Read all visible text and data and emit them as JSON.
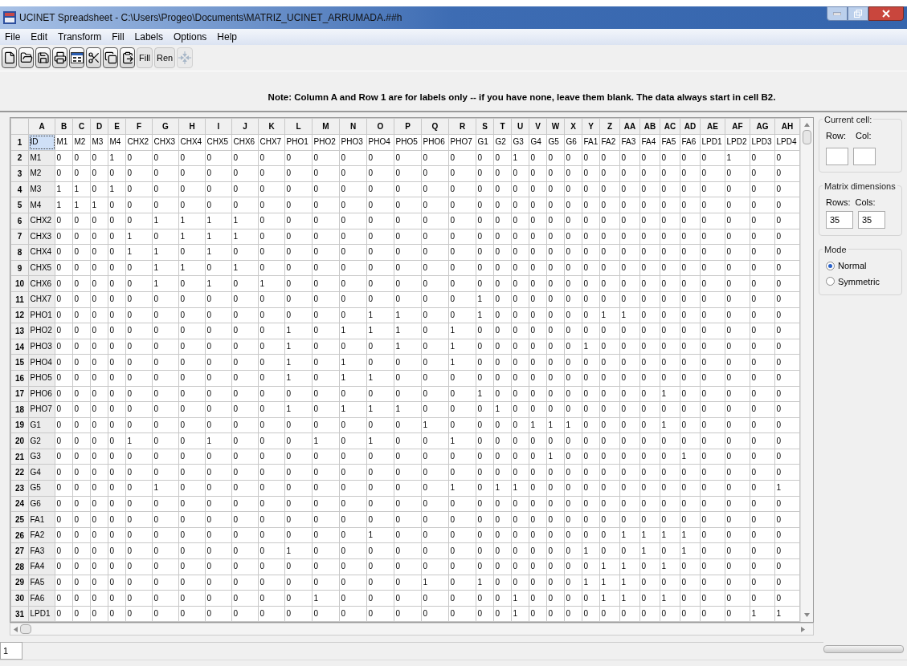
{
  "window": {
    "title": "UCINET Spreadsheet - C:\\Users\\Progeo\\Documents\\MATRIZ_UCINET_ARRUMADA.##h"
  },
  "menu": [
    "File",
    "Edit",
    "Transform",
    "Fill",
    "Labels",
    "Options",
    "Help"
  ],
  "toolbar": [
    {
      "kind": "new",
      "disabled": false
    },
    {
      "kind": "open",
      "disabled": false
    },
    {
      "kind": "save",
      "disabled": false
    },
    {
      "kind": "print",
      "disabled": false
    },
    {
      "kind": "grid",
      "disabled": false
    },
    {
      "kind": "cut",
      "disabled": false
    },
    {
      "kind": "copy",
      "disabled": false
    },
    {
      "kind": "paste",
      "disabled": false
    },
    {
      "kind": "text",
      "label": "Fill",
      "disabled": false
    },
    {
      "kind": "text",
      "label": "Ren",
      "disabled": false
    },
    {
      "kind": "arrows",
      "disabled": true
    }
  ],
  "note": "Note: Column A and Row 1 are for labels only  -- if you have none, leave them blank. The data always start in cell B2.",
  "grid": {
    "columns": [
      "A",
      "B",
      "C",
      "D",
      "E",
      "F",
      "G",
      "H",
      "I",
      "J",
      "K",
      "L",
      "M",
      "N",
      "O",
      "P",
      "Q",
      "R",
      "S",
      "T",
      "U",
      "V",
      "W",
      "X",
      "Y",
      "Z",
      "AA",
      "AB",
      "AC",
      "AD",
      "AE",
      "AF",
      "AG",
      "AH"
    ],
    "rows": [
      {
        "number": "1",
        "focused": true,
        "cells": [
          "ID",
          "M1",
          "M2",
          "M3",
          "M4",
          "CHX2",
          "CHX3",
          "CHX4",
          "CHX5",
          "CHX6",
          "CHX7",
          "PHO1",
          "PHO2",
          "PHO3",
          "PHO4",
          "PHO5",
          "PHO6",
          "PHO7",
          "G1",
          "G2",
          "G3",
          "G4",
          "G5",
          "G6",
          "FA1",
          "FA2",
          "FA3",
          "FA4",
          "FA5",
          "FA6",
          "LPD1",
          "LPD2",
          "LPD3",
          "LPD4"
        ]
      },
      {
        "number": "2",
        "focused": false,
        "cells": [
          "M1",
          "0",
          "0",
          "0",
          "1",
          "0",
          "0",
          "0",
          "0",
          "0",
          "0",
          "0",
          "0",
          "0",
          "0",
          "0",
          "0",
          "0",
          "0",
          "0",
          "1",
          "0",
          "0",
          "0",
          "0",
          "0",
          "0",
          "0",
          "0",
          "0",
          "0",
          "1",
          "0",
          "0"
        ]
      },
      {
        "number": "3",
        "focused": false,
        "cells": [
          "M2",
          "0",
          "0",
          "0",
          "0",
          "0",
          "0",
          "0",
          "0",
          "0",
          "0",
          "0",
          "0",
          "0",
          "0",
          "0",
          "0",
          "0",
          "0",
          "0",
          "0",
          "0",
          "0",
          "0",
          "0",
          "0",
          "0",
          "0",
          "0",
          "0",
          "0",
          "0",
          "0",
          "0"
        ]
      },
      {
        "number": "4",
        "focused": false,
        "cells": [
          "M3",
          "1",
          "1",
          "0",
          "1",
          "0",
          "0",
          "0",
          "0",
          "0",
          "0",
          "0",
          "0",
          "0",
          "0",
          "0",
          "0",
          "0",
          "0",
          "0",
          "0",
          "0",
          "0",
          "0",
          "0",
          "0",
          "0",
          "0",
          "0",
          "0",
          "0",
          "0",
          "0",
          "0"
        ]
      },
      {
        "number": "5",
        "focused": false,
        "cells": [
          "M4",
          "1",
          "1",
          "1",
          "0",
          "0",
          "0",
          "0",
          "0",
          "0",
          "0",
          "0",
          "0",
          "0",
          "0",
          "0",
          "0",
          "0",
          "0",
          "0",
          "0",
          "0",
          "0",
          "0",
          "0",
          "0",
          "0",
          "0",
          "0",
          "0",
          "0",
          "0",
          "0",
          "0"
        ]
      },
      {
        "number": "6",
        "focused": false,
        "cells": [
          "CHX2",
          "0",
          "0",
          "0",
          "0",
          "0",
          "1",
          "1",
          "1",
          "1",
          "0",
          "0",
          "0",
          "0",
          "0",
          "0",
          "0",
          "0",
          "0",
          "0",
          "0",
          "0",
          "0",
          "0",
          "0",
          "0",
          "0",
          "0",
          "0",
          "0",
          "0",
          "0",
          "0",
          "0"
        ]
      },
      {
        "number": "7",
        "focused": false,
        "cells": [
          "CHX3",
          "0",
          "0",
          "0",
          "0",
          "1",
          "0",
          "1",
          "1",
          "1",
          "0",
          "0",
          "0",
          "0",
          "0",
          "0",
          "0",
          "0",
          "0",
          "0",
          "0",
          "0",
          "0",
          "0",
          "0",
          "0",
          "0",
          "0",
          "0",
          "0",
          "0",
          "0",
          "0",
          "0"
        ]
      },
      {
        "number": "8",
        "focused": false,
        "cells": [
          "CHX4",
          "0",
          "0",
          "0",
          "0",
          "1",
          "1",
          "0",
          "1",
          "0",
          "0",
          "0",
          "0",
          "0",
          "0",
          "0",
          "0",
          "0",
          "0",
          "0",
          "0",
          "0",
          "0",
          "0",
          "0",
          "0",
          "0",
          "0",
          "0",
          "0",
          "0",
          "0",
          "0",
          "0"
        ]
      },
      {
        "number": "9",
        "focused": false,
        "cells": [
          "CHX5",
          "0",
          "0",
          "0",
          "0",
          "0",
          "1",
          "1",
          "0",
          "1",
          "0",
          "0",
          "0",
          "0",
          "0",
          "0",
          "0",
          "0",
          "0",
          "0",
          "0",
          "0",
          "0",
          "0",
          "0",
          "0",
          "0",
          "0",
          "0",
          "0",
          "0",
          "0",
          "0",
          "0"
        ]
      },
      {
        "number": "10",
        "focused": false,
        "cells": [
          "CHX6",
          "0",
          "0",
          "0",
          "0",
          "0",
          "1",
          "0",
          "1",
          "0",
          "1",
          "0",
          "0",
          "0",
          "0",
          "0",
          "0",
          "0",
          "0",
          "0",
          "0",
          "0",
          "0",
          "0",
          "0",
          "0",
          "0",
          "0",
          "0",
          "0",
          "0",
          "0",
          "0",
          "0"
        ]
      },
      {
        "number": "11",
        "focused": false,
        "cells": [
          "CHX7",
          "0",
          "0",
          "0",
          "0",
          "0",
          "0",
          "0",
          "0",
          "0",
          "0",
          "0",
          "0",
          "0",
          "0",
          "0",
          "0",
          "0",
          "1",
          "0",
          "0",
          "0",
          "0",
          "0",
          "0",
          "0",
          "0",
          "0",
          "0",
          "0",
          "0",
          "0",
          "0",
          "0"
        ]
      },
      {
        "number": "12",
        "focused": false,
        "cells": [
          "PHO1",
          "0",
          "0",
          "0",
          "0",
          "0",
          "0",
          "0",
          "0",
          "0",
          "0",
          "0",
          "0",
          "0",
          "1",
          "1",
          "0",
          "0",
          "1",
          "0",
          "0",
          "0",
          "0",
          "0",
          "0",
          "1",
          "1",
          "0",
          "0",
          "0",
          "0",
          "0",
          "0",
          "0"
        ]
      },
      {
        "number": "13",
        "focused": false,
        "cells": [
          "PHO2",
          "0",
          "0",
          "0",
          "0",
          "0",
          "0",
          "0",
          "0",
          "0",
          "0",
          "1",
          "0",
          "1",
          "1",
          "1",
          "0",
          "1",
          "0",
          "0",
          "0",
          "0",
          "0",
          "0",
          "0",
          "0",
          "0",
          "0",
          "0",
          "0",
          "0",
          "0",
          "0",
          "0"
        ]
      },
      {
        "number": "14",
        "focused": false,
        "cells": [
          "PHO3",
          "0",
          "0",
          "0",
          "0",
          "0",
          "0",
          "0",
          "0",
          "0",
          "0",
          "1",
          "0",
          "0",
          "0",
          "1",
          "0",
          "1",
          "0",
          "0",
          "0",
          "0",
          "0",
          "0",
          "1",
          "0",
          "0",
          "0",
          "0",
          "0",
          "0",
          "0",
          "0",
          "0"
        ]
      },
      {
        "number": "15",
        "focused": false,
        "cells": [
          "PHO4",
          "0",
          "0",
          "0",
          "0",
          "0",
          "0",
          "0",
          "0",
          "0",
          "0",
          "1",
          "0",
          "1",
          "0",
          "0",
          "0",
          "1",
          "0",
          "0",
          "0",
          "0",
          "0",
          "0",
          "0",
          "0",
          "0",
          "0",
          "0",
          "0",
          "0",
          "0",
          "0",
          "0"
        ]
      },
      {
        "number": "16",
        "focused": false,
        "cells": [
          "PHO5",
          "0",
          "0",
          "0",
          "0",
          "0",
          "0",
          "0",
          "0",
          "0",
          "0",
          "1",
          "0",
          "1",
          "1",
          "0",
          "0",
          "0",
          "0",
          "0",
          "0",
          "0",
          "0",
          "0",
          "0",
          "0",
          "0",
          "0",
          "0",
          "0",
          "0",
          "0",
          "0",
          "0"
        ]
      },
      {
        "number": "17",
        "focused": false,
        "cells": [
          "PHO6",
          "0",
          "0",
          "0",
          "0",
          "0",
          "0",
          "0",
          "0",
          "0",
          "0",
          "0",
          "0",
          "0",
          "0",
          "0",
          "0",
          "0",
          "1",
          "0",
          "0",
          "0",
          "0",
          "0",
          "0",
          "0",
          "0",
          "0",
          "1",
          "0",
          "0",
          "0",
          "0",
          "0"
        ]
      },
      {
        "number": "18",
        "focused": false,
        "cells": [
          "PHO7",
          "0",
          "0",
          "0",
          "0",
          "0",
          "0",
          "0",
          "0",
          "0",
          "0",
          "1",
          "0",
          "1",
          "1",
          "1",
          "0",
          "0",
          "0",
          "1",
          "0",
          "0",
          "0",
          "0",
          "0",
          "0",
          "0",
          "0",
          "0",
          "0",
          "0",
          "0",
          "0",
          "0"
        ]
      },
      {
        "number": "19",
        "focused": false,
        "cells": [
          "G1",
          "0",
          "0",
          "0",
          "0",
          "0",
          "0",
          "0",
          "0",
          "0",
          "0",
          "0",
          "0",
          "0",
          "0",
          "0",
          "1",
          "0",
          "0",
          "0",
          "0",
          "1",
          "1",
          "1",
          "0",
          "0",
          "0",
          "0",
          "1",
          "0",
          "0",
          "0",
          "0",
          "0"
        ]
      },
      {
        "number": "20",
        "focused": false,
        "cells": [
          "G2",
          "0",
          "0",
          "0",
          "0",
          "1",
          "0",
          "0",
          "1",
          "0",
          "0",
          "0",
          "1",
          "0",
          "1",
          "0",
          "0",
          "1",
          "0",
          "0",
          "0",
          "0",
          "0",
          "0",
          "0",
          "0",
          "0",
          "0",
          "0",
          "0",
          "0",
          "0",
          "0",
          "0"
        ]
      },
      {
        "number": "21",
        "focused": false,
        "cells": [
          "G3",
          "0",
          "0",
          "0",
          "0",
          "0",
          "0",
          "0",
          "0",
          "0",
          "0",
          "0",
          "0",
          "0",
          "0",
          "0",
          "0",
          "0",
          "0",
          "0",
          "0",
          "0",
          "1",
          "0",
          "0",
          "0",
          "0",
          "0",
          "0",
          "1",
          "0",
          "0",
          "0",
          "0"
        ]
      },
      {
        "number": "22",
        "focused": false,
        "cells": [
          "G4",
          "0",
          "0",
          "0",
          "0",
          "0",
          "0",
          "0",
          "0",
          "0",
          "0",
          "0",
          "0",
          "0",
          "0",
          "0",
          "0",
          "0",
          "0",
          "0",
          "0",
          "0",
          "0",
          "0",
          "0",
          "0",
          "0",
          "0",
          "0",
          "0",
          "0",
          "0",
          "0",
          "0"
        ]
      },
      {
        "number": "23",
        "focused": false,
        "cells": [
          "G5",
          "0",
          "0",
          "0",
          "0",
          "0",
          "1",
          "0",
          "0",
          "0",
          "0",
          "0",
          "0",
          "0",
          "0",
          "0",
          "0",
          "1",
          "0",
          "1",
          "1",
          "0",
          "0",
          "0",
          "0",
          "0",
          "0",
          "0",
          "0",
          "0",
          "0",
          "0",
          "0",
          "1"
        ]
      },
      {
        "number": "24",
        "focused": false,
        "cells": [
          "G6",
          "0",
          "0",
          "0",
          "0",
          "0",
          "0",
          "0",
          "0",
          "0",
          "0",
          "0",
          "0",
          "0",
          "0",
          "0",
          "0",
          "0",
          "0",
          "0",
          "0",
          "0",
          "0",
          "0",
          "0",
          "0",
          "0",
          "0",
          "0",
          "0",
          "0",
          "0",
          "0",
          "0"
        ]
      },
      {
        "number": "25",
        "focused": false,
        "cells": [
          "FA1",
          "0",
          "0",
          "0",
          "0",
          "0",
          "0",
          "0",
          "0",
          "0",
          "0",
          "0",
          "0",
          "0",
          "0",
          "0",
          "0",
          "0",
          "0",
          "0",
          "0",
          "0",
          "0",
          "0",
          "0",
          "0",
          "0",
          "0",
          "0",
          "0",
          "0",
          "0",
          "0",
          "0"
        ]
      },
      {
        "number": "26",
        "focused": false,
        "cells": [
          "FA2",
          "0",
          "0",
          "0",
          "0",
          "0",
          "0",
          "0",
          "0",
          "0",
          "0",
          "0",
          "0",
          "0",
          "1",
          "0",
          "0",
          "0",
          "0",
          "0",
          "0",
          "0",
          "0",
          "0",
          "0",
          "0",
          "1",
          "1",
          "1",
          "1",
          "0",
          "0",
          "0",
          "0"
        ]
      },
      {
        "number": "27",
        "focused": false,
        "cells": [
          "FA3",
          "0",
          "0",
          "0",
          "0",
          "0",
          "0",
          "0",
          "0",
          "0",
          "0",
          "1",
          "0",
          "0",
          "0",
          "0",
          "0",
          "0",
          "0",
          "0",
          "0",
          "0",
          "0",
          "0",
          "1",
          "0",
          "0",
          "1",
          "0",
          "1",
          "0",
          "0",
          "0",
          "0"
        ]
      },
      {
        "number": "28",
        "focused": false,
        "cells": [
          "FA4",
          "0",
          "0",
          "0",
          "0",
          "0",
          "0",
          "0",
          "0",
          "0",
          "0",
          "0",
          "0",
          "0",
          "0",
          "0",
          "0",
          "0",
          "0",
          "0",
          "0",
          "0",
          "0",
          "0",
          "0",
          "1",
          "1",
          "0",
          "1",
          "0",
          "0",
          "0",
          "0",
          "0"
        ]
      },
      {
        "number": "29",
        "focused": false,
        "cells": [
          "FA5",
          "0",
          "0",
          "0",
          "0",
          "0",
          "0",
          "0",
          "0",
          "0",
          "0",
          "0",
          "0",
          "0",
          "0",
          "0",
          "1",
          "0",
          "1",
          "0",
          "0",
          "0",
          "0",
          "0",
          "1",
          "1",
          "1",
          "0",
          "0",
          "0",
          "0",
          "0",
          "0",
          "0"
        ]
      },
      {
        "number": "30",
        "focused": false,
        "cells": [
          "FA6",
          "0",
          "0",
          "0",
          "0",
          "0",
          "0",
          "0",
          "0",
          "0",
          "0",
          "0",
          "1",
          "0",
          "0",
          "0",
          "0",
          "0",
          "0",
          "0",
          "1",
          "0",
          "0",
          "0",
          "0",
          "1",
          "1",
          "0",
          "1",
          "0",
          "0",
          "0",
          "0",
          "0"
        ]
      },
      {
        "number": "31",
        "focused": false,
        "cells": [
          "LPD1",
          "0",
          "0",
          "0",
          "0",
          "0",
          "0",
          "0",
          "0",
          "0",
          "0",
          "0",
          "0",
          "0",
          "0",
          "0",
          "0",
          "0",
          "0",
          "0",
          "1",
          "0",
          "0",
          "0",
          "0",
          "0",
          "0",
          "0",
          "0",
          "0",
          "0",
          "0",
          "1",
          "1"
        ]
      }
    ]
  },
  "current_cell": {
    "title": "Current cell:",
    "row_label": "Row:",
    "col_label": "Col:"
  },
  "matrix_dimensions": {
    "title": "Matrix dimensions",
    "rows_label": "Rows:",
    "cols_label": "Cols:",
    "rows": "35",
    "cols": "35"
  },
  "mode": {
    "title": "Mode",
    "options": [
      {
        "label": "Normal",
        "selected": true
      },
      {
        "label": "Symmetric",
        "selected": false
      }
    ]
  },
  "status": {
    "cell_value": "1"
  }
}
